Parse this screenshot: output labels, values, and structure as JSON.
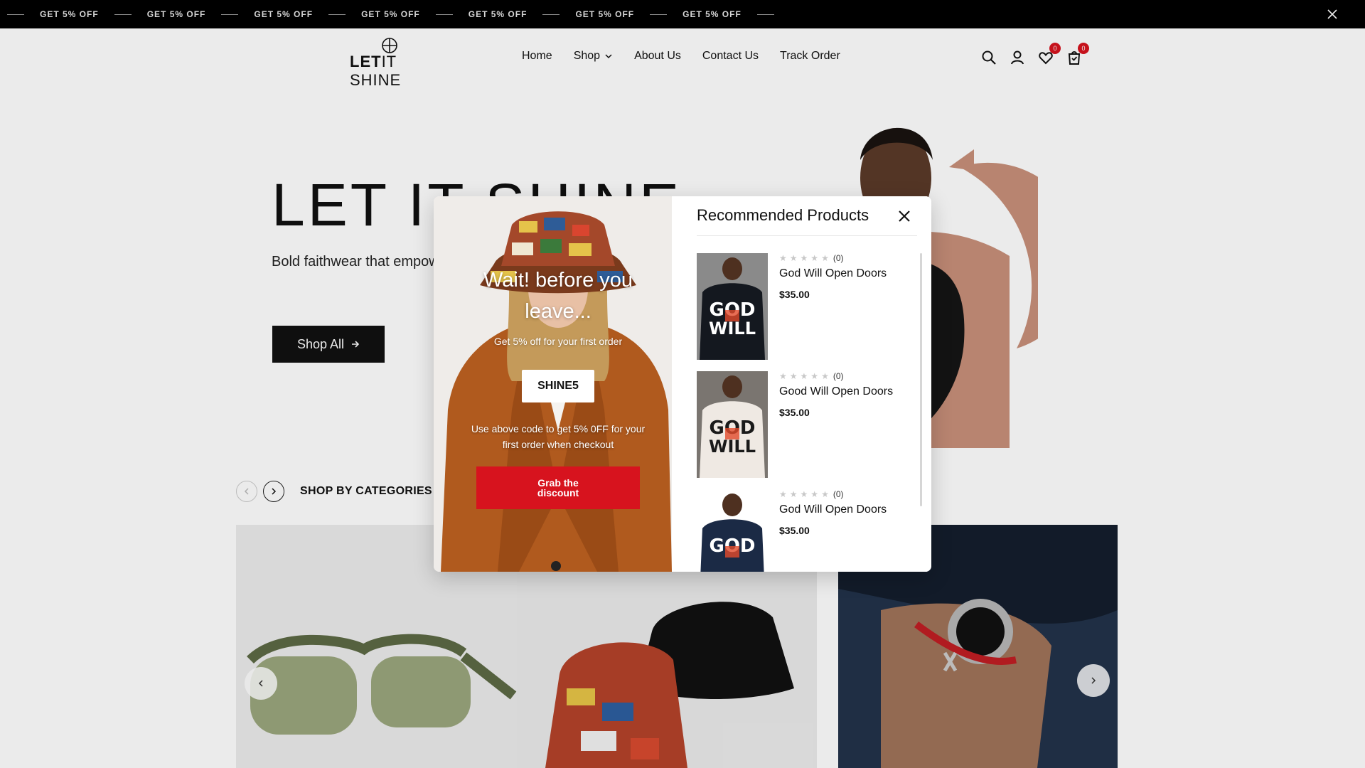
{
  "announcement": {
    "promos": [
      "GET 5% OFF",
      "GET 5% OFF",
      "GET 5% OFF",
      "GET 5% OFF",
      "GET 5% OFF",
      "GET 5% OFF",
      "GET 5% OFF"
    ]
  },
  "header": {
    "logo_bold": "LET",
    "logo_light": "IT SHINE",
    "nav": [
      "Home",
      "Shop",
      "About Us",
      "Contact Us",
      "Track Order"
    ],
    "wishlist_count": "0",
    "cart_count": "0"
  },
  "hero": {
    "title": "LET IT SHINE",
    "subtitle": "Bold faithwear that empowers and inspires your shine.",
    "cta": "Shop All"
  },
  "categories": {
    "title": "SHOP BY CATEGORIES"
  },
  "popup": {
    "heading": "Wait! before you leave...",
    "offer": "Get 5% off for your first order",
    "code": "SHINE5",
    "note": "Use above code to get 5% 0FF for your first order when checkout",
    "button": "Grab the discount"
  },
  "recommended": {
    "title": "Recommended Products",
    "items": [
      {
        "rating_count": "(0)",
        "name": "God Will Open Doors",
        "price": "$35.00",
        "shirt_color": "#14181f",
        "print_color": "#ffffff"
      },
      {
        "rating_count": "(0)",
        "name": "Good Will Open Doors",
        "price": "$35.00",
        "shirt_color": "#efe9e3",
        "print_color": "#1a1a1a"
      },
      {
        "rating_count": "(0)",
        "name": "God Will Open Doors",
        "price": "$35.00",
        "shirt_color": "#1b2a45",
        "print_color": "#ffffff"
      }
    ]
  },
  "colors": {
    "accent_red": "#d7131e",
    "dark": "#111111"
  }
}
